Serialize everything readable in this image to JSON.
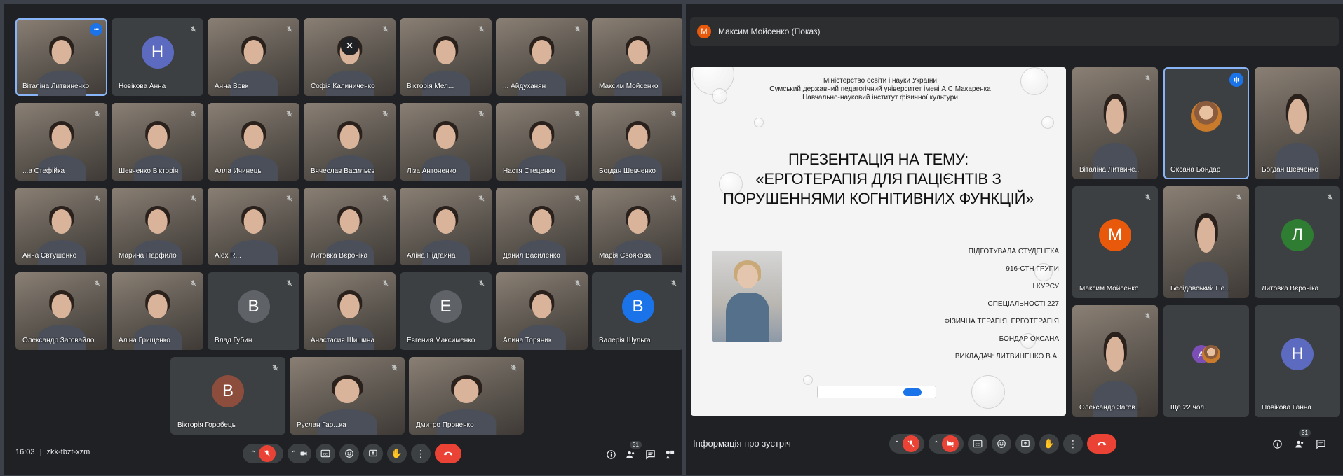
{
  "left": {
    "tiles": [
      {
        "name": "Віталіна Литвиненко",
        "type": "video",
        "active": true,
        "menu": true
      },
      {
        "name": "Новікова Анна",
        "type": "avatar",
        "letter": "Н",
        "color": "#5c6bc0",
        "muted": true
      },
      {
        "name": "Анна Вовк",
        "type": "video",
        "muted": true
      },
      {
        "name": "Софія Калиниченко",
        "type": "video",
        "muted": true,
        "closed": true
      },
      {
        "name": "Вікторія Мел...",
        "type": "video",
        "muted": true
      },
      {
        "name": "... Айдуханян",
        "type": "video",
        "muted": true
      },
      {
        "name": "Максим Мойсенко",
        "type": "video",
        "muted": false
      },
      {
        "name": "...а Стефійка",
        "type": "video",
        "muted": true
      },
      {
        "name": "Шевченко Вікторія",
        "type": "video",
        "muted": true
      },
      {
        "name": "Алла Ичинець",
        "type": "video",
        "muted": true
      },
      {
        "name": "Вячеслав Васильєв",
        "type": "video",
        "muted": true
      },
      {
        "name": "Ліза Антоненко",
        "type": "video",
        "muted": true
      },
      {
        "name": "Настя Стеценко",
        "type": "video",
        "muted": true
      },
      {
        "name": "Богдан Шевченко",
        "type": "video",
        "muted": true
      },
      {
        "name": "Анна Євтушенко",
        "type": "video",
        "muted": true
      },
      {
        "name": "Марина Парфило",
        "type": "video",
        "muted": true
      },
      {
        "name": "Alex R...",
        "type": "video",
        "muted": true
      },
      {
        "name": "Литовка Вєроніка",
        "type": "video",
        "muted": true
      },
      {
        "name": "Аліна Підгайна",
        "type": "video",
        "muted": true
      },
      {
        "name": "Данил Василенко",
        "type": "video",
        "muted": true
      },
      {
        "name": "Марія Своякова",
        "type": "video",
        "muted": true
      },
      {
        "name": "Олександр Заговайло",
        "type": "video",
        "muted": true
      },
      {
        "name": "Аліна Грищенко",
        "type": "video",
        "muted": true
      },
      {
        "name": "Влад Губин",
        "type": "avatar",
        "letter": "В",
        "color": "#5f6368",
        "muted": true
      },
      {
        "name": "Анастасия Шишина",
        "type": "video",
        "muted": true
      },
      {
        "name": "Евгения Максименко",
        "type": "avatar",
        "letter": "Е",
        "color": "#5f6368",
        "muted": true
      },
      {
        "name": "Алина Торяник",
        "type": "video",
        "muted": true
      },
      {
        "name": "Валерія Шульга",
        "type": "avatar",
        "letter": "В",
        "color": "#1a73e8",
        "muted": true
      },
      {
        "name": "Вікторія Горобець",
        "type": "avatar",
        "letter": "В",
        "color": "#8d4d3c",
        "muted": true
      },
      {
        "name": "Руслан Гар...ка",
        "type": "video",
        "muted": true
      },
      {
        "name": "Дмитро Проненко",
        "type": "video",
        "muted": true
      }
    ],
    "time": "16:03",
    "meeting_code": "zkk-tbzt-xzm",
    "people_count": "31"
  },
  "right": {
    "presenter_letter": "М",
    "presenter": "Максим Мойсенко (Показ)",
    "slide": {
      "org_lines": [
        "Міністерство освіти і науки України",
        "Сумський державний педагогічний університет імені А.С Макаренка",
        "Навчально-науковий інститут фізичної культури"
      ],
      "title_lines": [
        "ПРЕЗЕНТАЦІЯ НА ТЕМУ:",
        "«ЕРГОТЕРАПІЯ ДЛЯ ПАЦІЄНТІВ З",
        "ПОРУШЕННЯМИ КОГНІТИВНИХ ФУНКЦІЙ»"
      ],
      "info_lines": [
        "ПІДГОТУВАЛА СТУДЕНТКА",
        "916-СТН ГРУПИ",
        "I КУРСУ",
        "СПЕЦІАЛЬНОСТІ 227",
        "ФІЗИЧНА ТЕРАПІЯ, ЕРГОТЕРАПІЯ",
        "БОНДАР ОКСАНА",
        "ВИКЛАДАЧ: ЛИТВИНЕНКО В.А."
      ]
    },
    "tiles": [
      {
        "name": "Віталіна Литвине...",
        "type": "video",
        "muted": true
      },
      {
        "name": "Оксана Бондар",
        "type": "photo",
        "active": true,
        "speaking": true
      },
      {
        "name": "Богдан Шевченко",
        "type": "video",
        "muted": false
      },
      {
        "name": "Максим Мойсенко",
        "type": "avatar",
        "letter": "М",
        "color": "#e8590c",
        "muted": true
      },
      {
        "name": "Бесідовський Пе...",
        "type": "video",
        "muted": true
      },
      {
        "name": "Литовка Вєроніка",
        "type": "avatar",
        "letter": "Л",
        "color": "#2e7d32",
        "muted": true
      },
      {
        "name": "Олександр Загов...",
        "type": "video",
        "muted": true
      },
      {
        "name": "Ще 22 чол.",
        "type": "more",
        "letter": "А"
      },
      {
        "name": "Новікова Ганна",
        "type": "avatar",
        "letter": "Н",
        "color": "#5c6bc0",
        "muted": false
      }
    ],
    "meeting_info": "Інформація про зустріч",
    "people_count": "31"
  }
}
